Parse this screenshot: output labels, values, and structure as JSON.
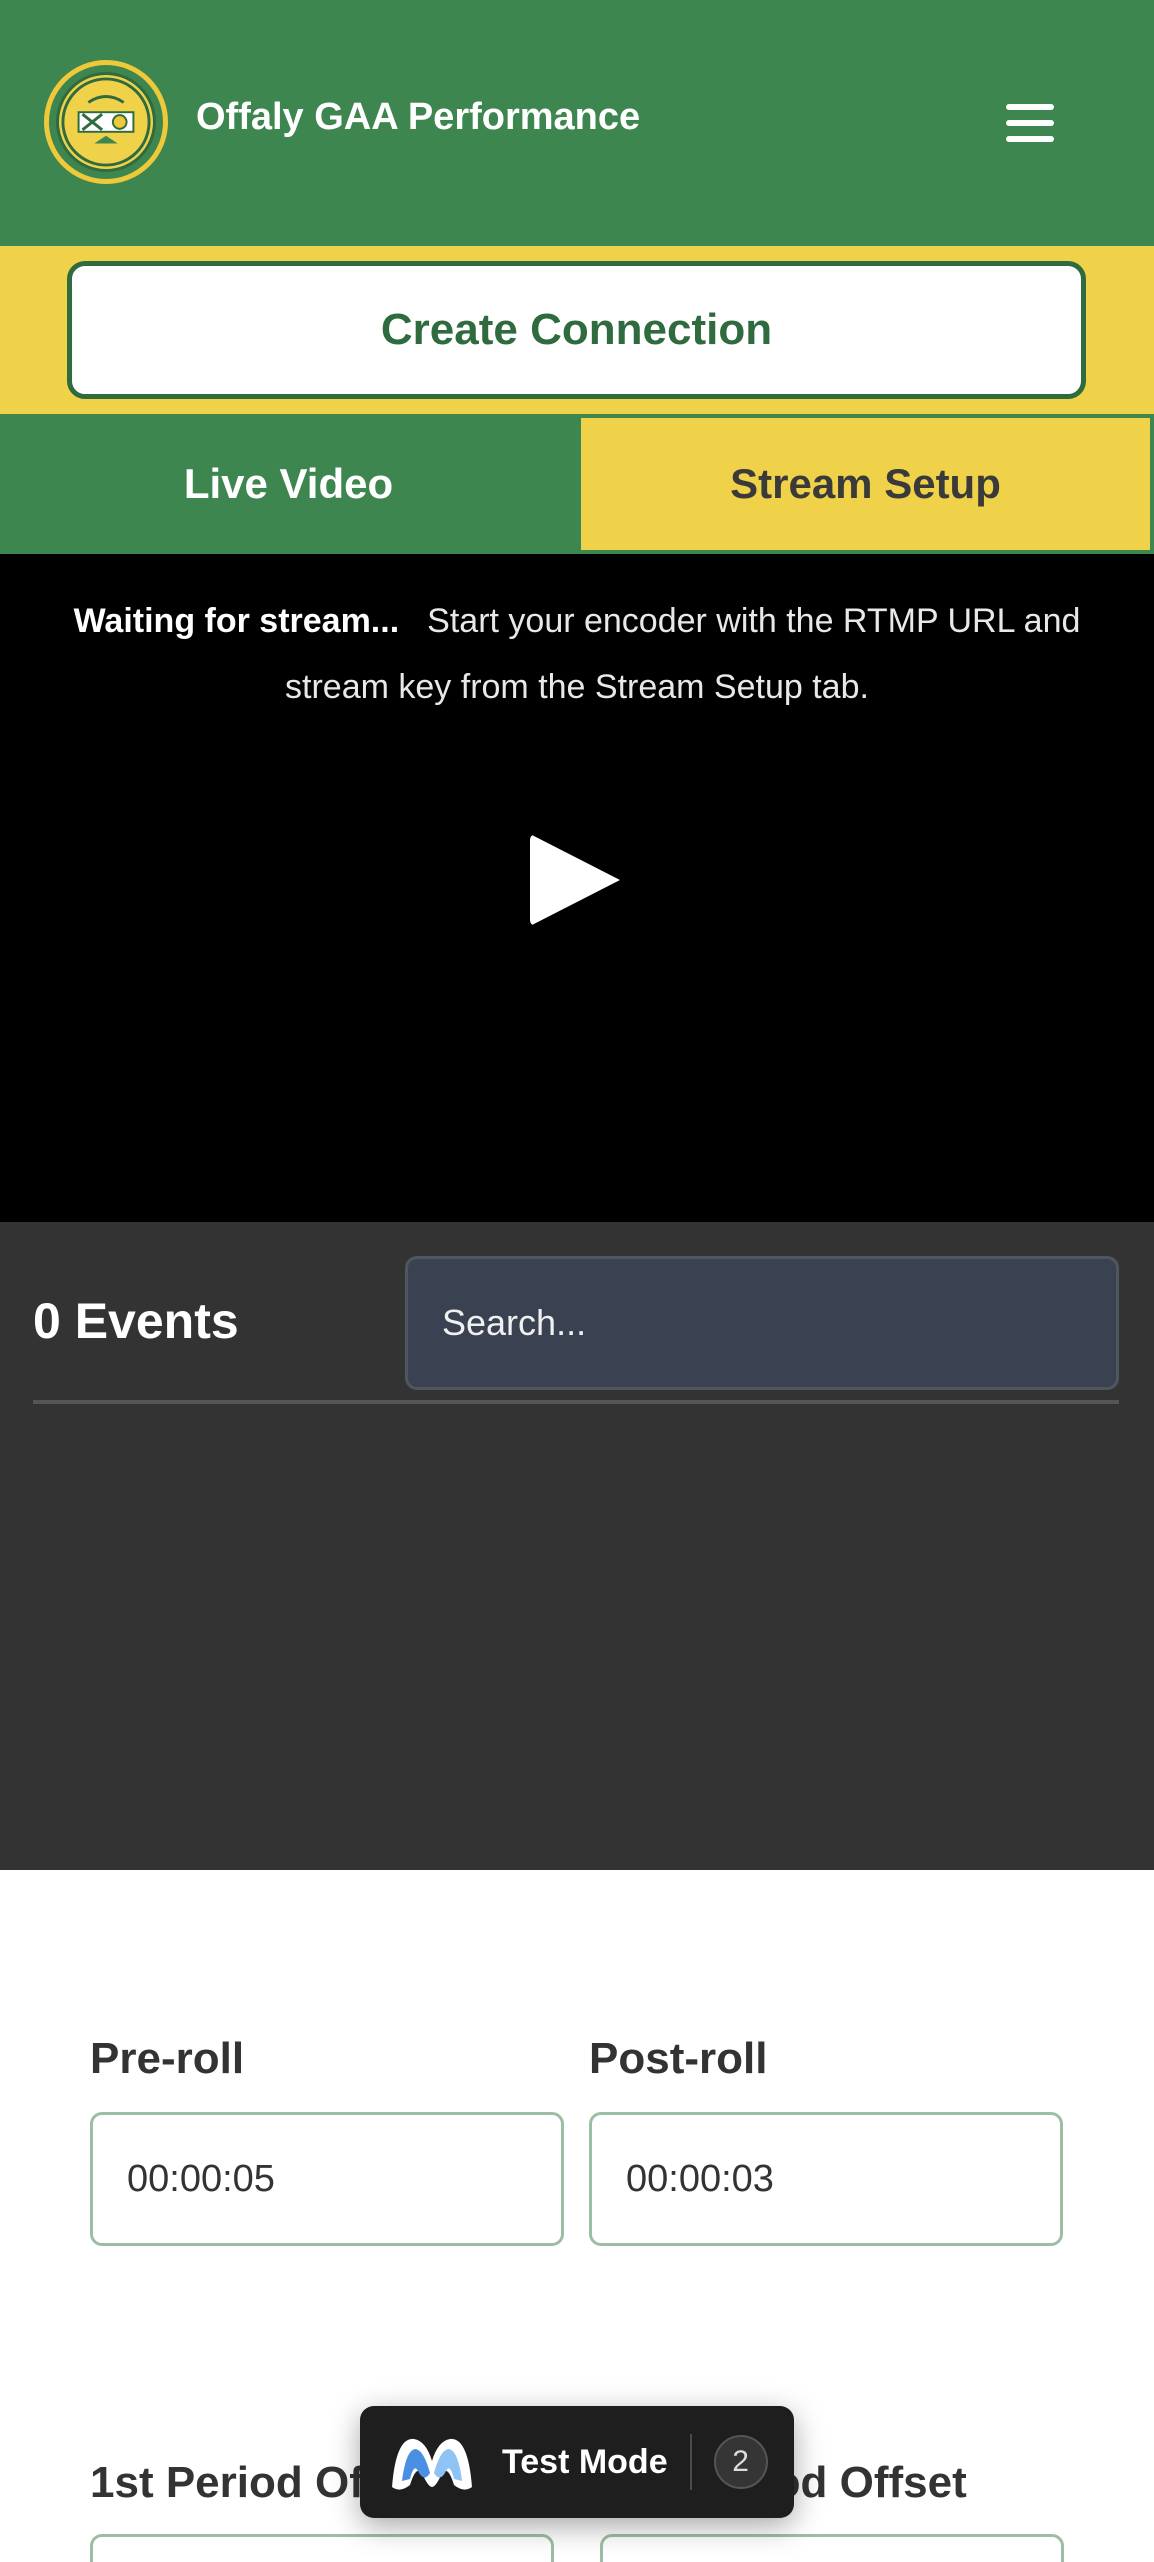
{
  "header": {
    "title": "Offaly GAA Performance",
    "logo_text": "UÍBH FHAILÍ",
    "menu_icon": "hamburger-menu-icon"
  },
  "connection": {
    "button_label": "Create Connection"
  },
  "tabs": [
    {
      "label": "Live Video"
    },
    {
      "label": "Stream Setup"
    }
  ],
  "video": {
    "status": "Waiting for stream...",
    "message": "Start your encoder with the RTMP URL and stream key from the Stream Setup tab.",
    "play_icon": "play-icon"
  },
  "events": {
    "title": "0 Events",
    "search_placeholder": "Search..."
  },
  "clip": {
    "preroll_label": "Pre-roll",
    "preroll_value": "00:00:05",
    "postroll_label": "Post-roll",
    "postroll_value": "00:00:03"
  },
  "periods": {
    "first_label": "1st Period Offset",
    "second_label": "2nd Period Offset"
  },
  "test_mode": {
    "label": "Test Mode",
    "count": "2"
  }
}
